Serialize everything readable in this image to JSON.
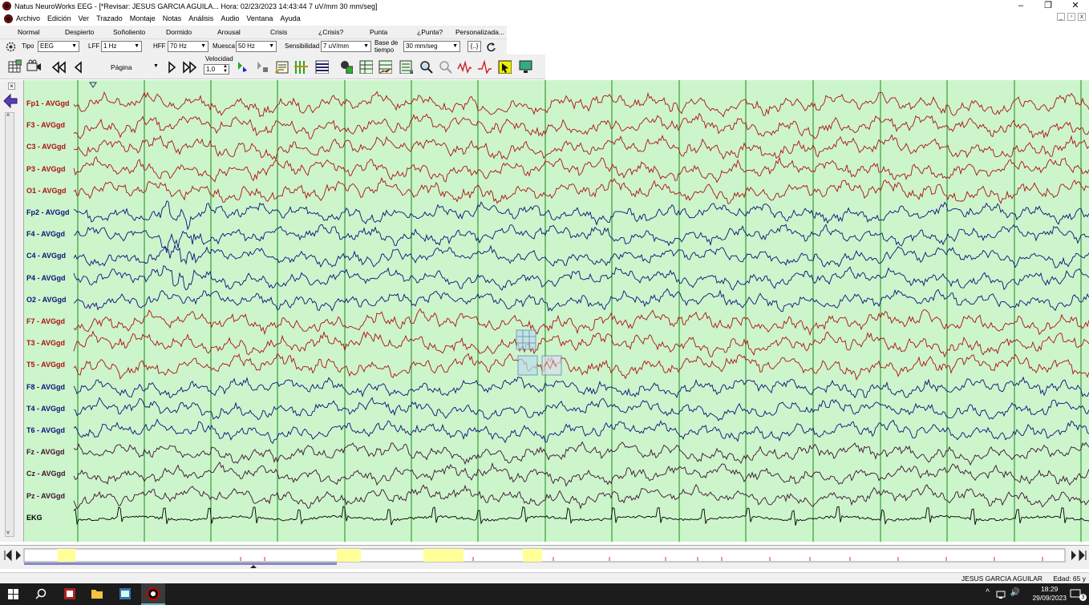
{
  "window": {
    "title": "Natus NeuroWorks EEG - [*Revisar:  JESUS  GARCIA AGUILA...  Hora: 02/23/2023 14:43:44   7 uV/mm   30 mm/seg]",
    "controls": [
      "–",
      "❐",
      "✕"
    ]
  },
  "menu": {
    "items": [
      "Archivo",
      "Edición",
      "Ver",
      "Trazado",
      "Montaje",
      "Notas",
      "Análisis",
      "Audio",
      "Ventana",
      "Ayuda"
    ]
  },
  "states": [
    "Normal",
    "Despierto",
    "Soñoliento",
    "Dormido",
    "Arousal",
    "Crisis",
    "¿Crisis?",
    "Punta",
    "¿Punta?",
    "Personalizada..."
  ],
  "filters": {
    "tipo_label": "Tipo",
    "tipo_value": "EEG",
    "lff_label": "LFF",
    "lff_value": "1 Hz",
    "hff_label": "HFF",
    "hff_value": "70 Hz",
    "muesca_label": "Muesca",
    "muesca_value": "50 Hz",
    "sens_label": "Sensibilidad",
    "sens_value": "7 uV/mm",
    "base_label_1": "Base de",
    "base_label_2": "tiempo",
    "base_value": "30 mm/seg",
    "bracket_btn": "{..}"
  },
  "toolbar": {
    "pagina_label": "Página",
    "velocidad_label": "Velocidad",
    "velocidad_value": "1,0"
  },
  "channels": [
    {
      "label": "Fp1 - AVGgd",
      "color": "#b01010"
    },
    {
      "label": "F3 - AVGgd",
      "color": "#b01010"
    },
    {
      "label": "C3 - AVGgd",
      "color": "#b01010"
    },
    {
      "label": "P3 - AVGgd",
      "color": "#b01010"
    },
    {
      "label": "O1 - AVGgd",
      "color": "#b01010"
    },
    {
      "label": "Fp2 - AVGgd",
      "color": "#10107a"
    },
    {
      "label": "F4 - AVGgd",
      "color": "#10107a"
    },
    {
      "label": "C4 - AVGgd",
      "color": "#10107a"
    },
    {
      "label": "P4 - AVGgd",
      "color": "#10107a"
    },
    {
      "label": "O2 - AVGgd",
      "color": "#10107a"
    },
    {
      "label": "F7 - AVGgd",
      "color": "#b01010"
    },
    {
      "label": "T3 - AVGgd",
      "color": "#b01010"
    },
    {
      "label": "T5 - AVGgd",
      "color": "#b01010"
    },
    {
      "label": "F8 - AVGgd",
      "color": "#10107a"
    },
    {
      "label": "T4 - AVGgd",
      "color": "#10107a"
    },
    {
      "label": "T6 - AVGgd",
      "color": "#10107a"
    },
    {
      "label": "Fz - AVGgd",
      "color": "#401030"
    },
    {
      "label": "Cz - AVGgd",
      "color": "#401030"
    },
    {
      "label": "Pz - AVGgd",
      "color": "#401030"
    },
    {
      "label": "EKG",
      "color": "#000000"
    }
  ],
  "footer": {
    "patient": "JESUS  GARCIA AGUILAR",
    "age": "Edad: 65 y"
  },
  "taskbar": {
    "time": "18:29",
    "date": "29/09/2023",
    "notif_count": "3"
  }
}
